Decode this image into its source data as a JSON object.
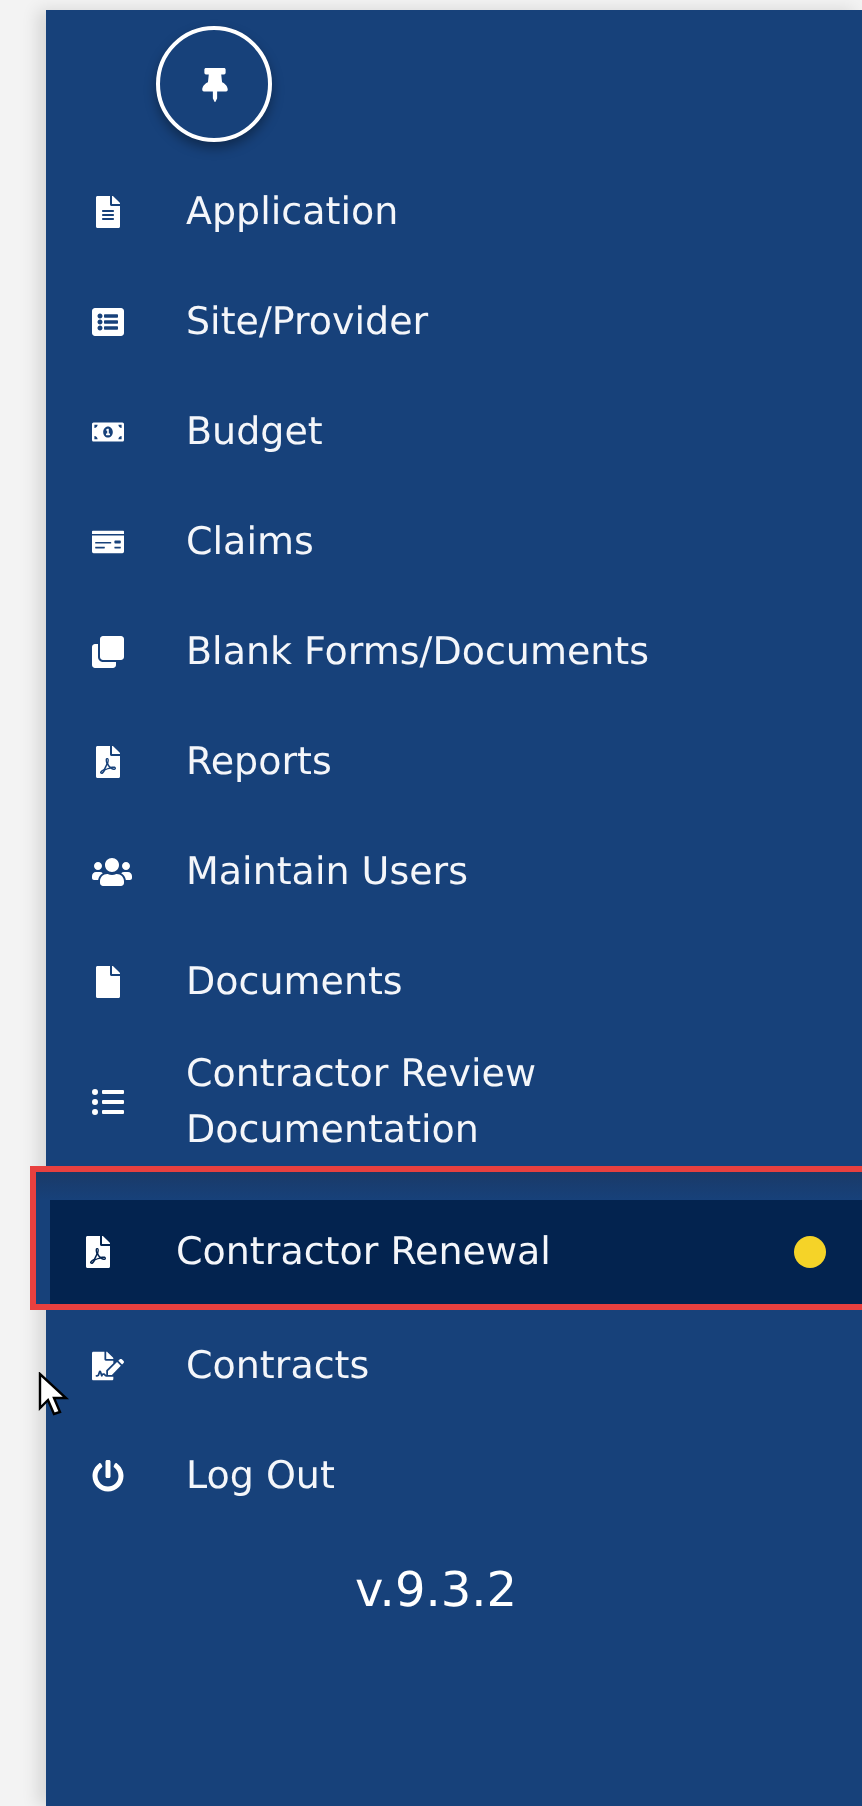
{
  "sidebar": {
    "pinned": true,
    "items": [
      {
        "label": "Application",
        "selected": false,
        "highlighted": false,
        "indicator": false
      },
      {
        "label": "Site/Provider",
        "selected": false,
        "highlighted": false,
        "indicator": false
      },
      {
        "label": "Budget",
        "selected": false,
        "highlighted": false,
        "indicator": false
      },
      {
        "label": "Claims",
        "selected": false,
        "highlighted": false,
        "indicator": false
      },
      {
        "label": "Blank Forms/Documents",
        "selected": false,
        "highlighted": false,
        "indicator": false
      },
      {
        "label": "Reports",
        "selected": false,
        "highlighted": false,
        "indicator": false
      },
      {
        "label": "Maintain Users",
        "selected": false,
        "highlighted": false,
        "indicator": false
      },
      {
        "label": "Documents",
        "selected": false,
        "highlighted": false,
        "indicator": false
      },
      {
        "label": "Contractor Review Documentation",
        "selected": false,
        "highlighted": false,
        "indicator": false
      },
      {
        "label": "Contractor Renewal",
        "selected": true,
        "highlighted": true,
        "indicator": true
      },
      {
        "label": "Contracts",
        "selected": false,
        "highlighted": false,
        "indicator": false
      },
      {
        "label": "Log Out",
        "selected": false,
        "highlighted": false,
        "indicator": false
      }
    ],
    "version": "v.9.3.2"
  }
}
